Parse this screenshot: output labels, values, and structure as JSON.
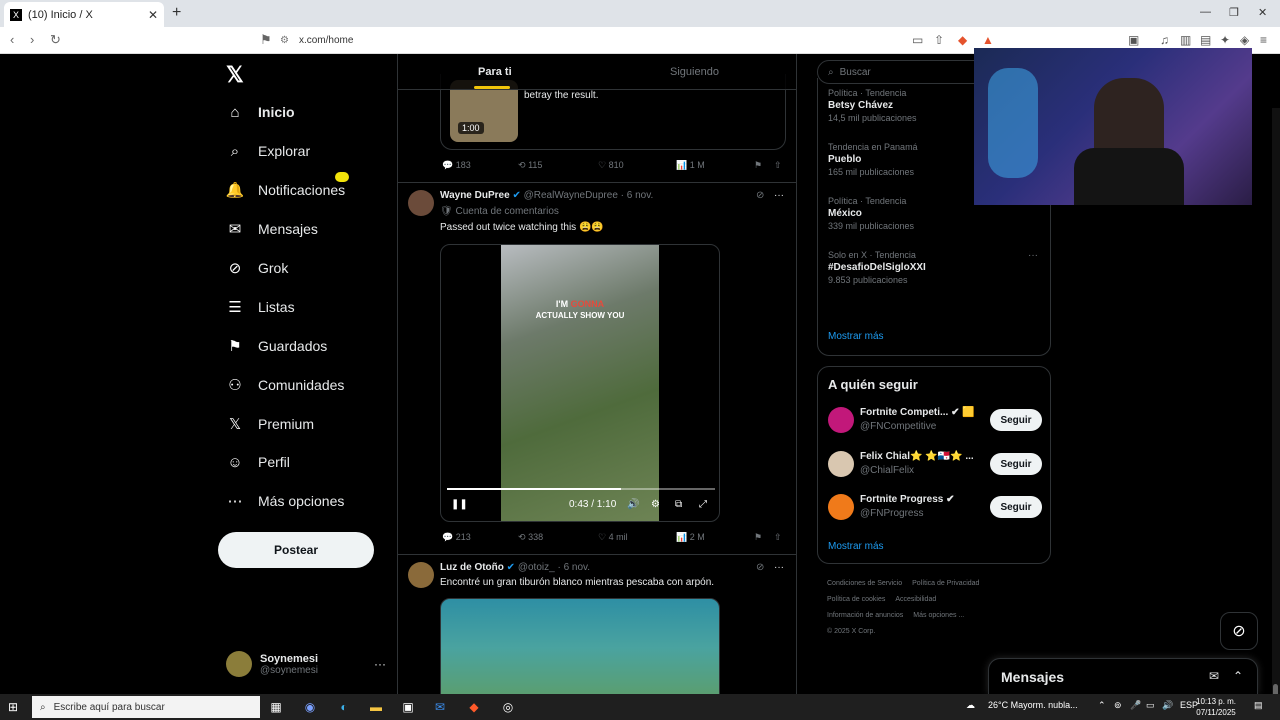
{
  "browser": {
    "tab_title": "(10) Inicio / X",
    "tab_close": "✕",
    "new_tab": "+",
    "url": "x.com/home",
    "back": "‹",
    "forward": "›",
    "reload": "↻",
    "minimize": "—",
    "maximize": "❐",
    "close": "✕"
  },
  "nav": {
    "logo": "𝕏",
    "items": [
      {
        "label": "Inicio",
        "icon": "home-icon",
        "glyph": "⌂"
      },
      {
        "label": "Explorar",
        "icon": "search-icon",
        "glyph": "⌕"
      },
      {
        "label": "Notificaciones",
        "icon": "bell-icon",
        "glyph": "🔔"
      },
      {
        "label": "Mensajes",
        "icon": "mail-icon",
        "glyph": "✉"
      },
      {
        "label": "Grok",
        "icon": "grok-icon",
        "glyph": "⊘"
      },
      {
        "label": "Listas",
        "icon": "list-icon",
        "glyph": "☰"
      },
      {
        "label": "Guardados",
        "icon": "bookmark-icon",
        "glyph": "⚑"
      },
      {
        "label": "Comunidades",
        "icon": "people-icon",
        "glyph": "⚇"
      },
      {
        "label": "Premium",
        "icon": "x-premium-icon",
        "glyph": "𝕏"
      },
      {
        "label": "Perfil",
        "icon": "person-icon",
        "glyph": "☺"
      },
      {
        "label": "Más opciones",
        "icon": "more-circle-icon",
        "glyph": "⋯"
      }
    ],
    "post_button": "Postear",
    "account": {
      "name": "Soynemesi",
      "handle": "@soynemesi",
      "more": "···"
    }
  },
  "timeline": {
    "tabs": {
      "for_you": "Para ti",
      "following": "Siguiendo"
    },
    "previous": {
      "media_duration": "1:00",
      "text": "betray the result.",
      "replies": "183",
      "reposts": "115",
      "likes": "810",
      "views": "1 M"
    },
    "tweet1": {
      "name": "Wayne DuPree",
      "verified": "✔",
      "handle": "@RealWayneDupree",
      "date": "· 6 nov.",
      "label": "Cuenta de comentarios",
      "text": "Passed out twice watching this 😩😩",
      "caption_top_a": "I'M ",
      "caption_top_b": "GONNA",
      "caption_bottom": "ACTUALLY SHOW YOU",
      "progress": 0.65,
      "time": "0:43 / 1:10",
      "replies": "213",
      "reposts": "338",
      "likes": "4 mil",
      "views": "2 M"
    },
    "tweet2": {
      "name": "Luz de Otoño",
      "verified": "✔",
      "handle": "@otoiz_",
      "date": "· 6 nov.",
      "text": "Encontré un gran tiburón blanco mientras pescaba con arpón."
    },
    "icons": {
      "reply": "💬",
      "repost": "⟲",
      "like": "♡",
      "views": "📊",
      "bookmark": "⚑",
      "share": "⇧",
      "more": "···",
      "grok": "⊘"
    }
  },
  "sidebar": {
    "search_placeholder": "Buscar",
    "trends": [
      {
        "context": "Política · Tendencia",
        "title": "Betsy Chávez",
        "posts": "14,5 mil publicaciones"
      },
      {
        "context": "Tendencia en Panamá",
        "title": "Pueblo",
        "posts": "165 mil publicaciones"
      },
      {
        "context": "Política · Tendencia",
        "title": "México",
        "posts": "339 mil publicaciones"
      },
      {
        "context": "Solo en X · Tendencia",
        "title": "#DesafioDelSigloXXI",
        "posts": "9.853 publicaciones"
      }
    ],
    "show_more": "Mostrar más",
    "who_to_follow": {
      "title": "A quién seguir",
      "accounts": [
        {
          "name": "Fortnite Competi... ✔ 🟨",
          "handle": "@FNCompetitive",
          "button": "Seguir",
          "color": "#c2187a"
        },
        {
          "name": "Felix Chial⭐ ⭐🇵🇦⭐ ...",
          "handle": "@ChialFelix",
          "button": "Seguir",
          "color": "#d9c7b0"
        },
        {
          "name": "Fortnite Progress ✔",
          "handle": "@FNProgress",
          "button": "Seguir",
          "color": "#f07a1a"
        }
      ],
      "show_more": "Mostrar más"
    },
    "footer": [
      "Condiciones de Servicio",
      "Política de Privacidad",
      "Política de cookies",
      "Accesibilidad",
      "Información de anuncios",
      "Más opciones ...",
      "© 2025 X Corp."
    ]
  },
  "messages_dock": {
    "title": "Mensajes",
    "compose": "✉",
    "expand": "⌃"
  },
  "taskbar": {
    "search_placeholder": "Escribe aquí para buscar",
    "weather": "26°C  Mayorm. nubla...",
    "lang": "ESP",
    "time": "10:13 p. m.",
    "date": "07/11/2025"
  }
}
